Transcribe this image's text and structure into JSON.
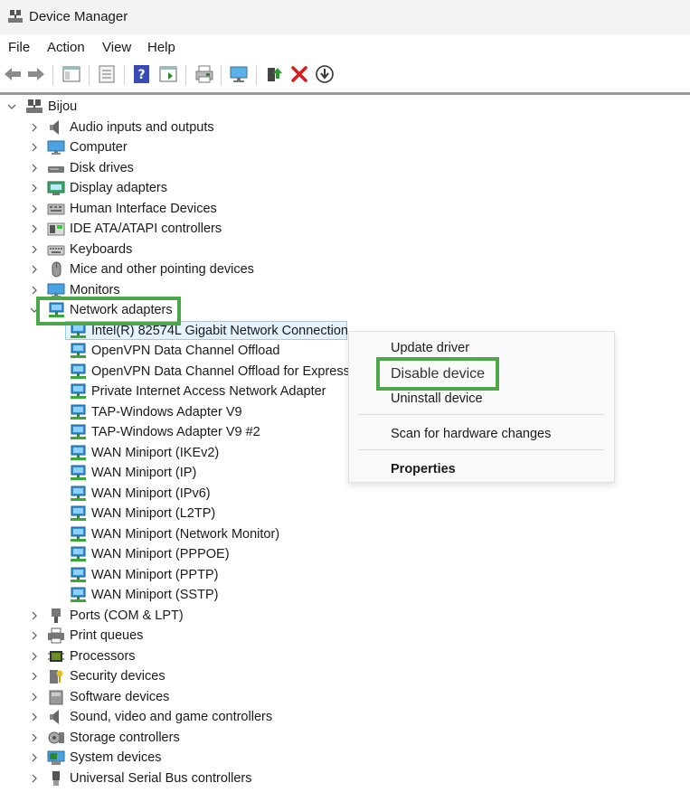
{
  "window": {
    "title": "Device Manager"
  },
  "menu": [
    "File",
    "Action",
    "View",
    "Help"
  ],
  "toolbar_icons": [
    "back-arrow-icon",
    "forward-arrow-icon",
    "show-hide-console-tree-icon",
    "properties-icon",
    "help-icon",
    "action-pane-icon",
    "print-icon",
    "scan-monitor-icon",
    "update-driver-icon",
    "uninstall-icon",
    "disable-device-icon"
  ],
  "tree": {
    "root": "Bijou",
    "categories": [
      {
        "label": "Audio inputs and outputs",
        "icon": "speaker-icon"
      },
      {
        "label": "Computer",
        "icon": "computer-icon"
      },
      {
        "label": "Disk drives",
        "icon": "disk-drive-icon"
      },
      {
        "label": "Display adapters",
        "icon": "display-adapter-icon"
      },
      {
        "label": "Human Interface Devices",
        "icon": "hid-icon"
      },
      {
        "label": "IDE ATA/ATAPI controllers",
        "icon": "ide-controller-icon"
      },
      {
        "label": "Keyboards",
        "icon": "keyboard-icon"
      },
      {
        "label": "Mice and other pointing devices",
        "icon": "mouse-icon"
      },
      {
        "label": "Monitors",
        "icon": "monitor-icon"
      },
      {
        "label": "Network adapters",
        "icon": "network-adapter-icon",
        "expanded": true
      }
    ],
    "network_children": [
      "Intel(R) 82574L Gigabit Network Connection",
      "OpenVPN Data Channel Offload",
      "OpenVPN Data Channel Offload for Express",
      "Private Internet Access Network Adapter",
      "TAP-Windows Adapter V9",
      "TAP-Windows Adapter V9 #2",
      "WAN Miniport (IKEv2)",
      "WAN Miniport (IP)",
      "WAN Miniport (IPv6)",
      "WAN Miniport (L2TP)",
      "WAN Miniport (Network Monitor)",
      "WAN Miniport (PPPOE)",
      "WAN Miniport (PPTP)",
      "WAN Miniport (SSTP)"
    ],
    "categories_after": [
      {
        "label": "Ports (COM & LPT)",
        "icon": "port-icon"
      },
      {
        "label": "Print queues",
        "icon": "printer-icon"
      },
      {
        "label": "Processors",
        "icon": "processor-icon"
      },
      {
        "label": "Security devices",
        "icon": "security-device-icon"
      },
      {
        "label": "Software devices",
        "icon": "software-device-icon"
      },
      {
        "label": "Sound, video and game controllers",
        "icon": "sound-icon"
      },
      {
        "label": "Storage controllers",
        "icon": "storage-controller-icon"
      },
      {
        "label": "System devices",
        "icon": "system-device-icon"
      },
      {
        "label": "Universal Serial Bus controllers",
        "icon": "usb-icon"
      }
    ]
  },
  "context_menu": {
    "update_driver": "Update driver",
    "disable_device": "Disable device",
    "uninstall_device": "Uninstall device",
    "scan": "Scan for hardware changes",
    "properties": "Properties"
  },
  "colors": {
    "highlight": "#4ea64a",
    "selection": "#e5f3ff",
    "network_icon": "#2f8fd8"
  }
}
